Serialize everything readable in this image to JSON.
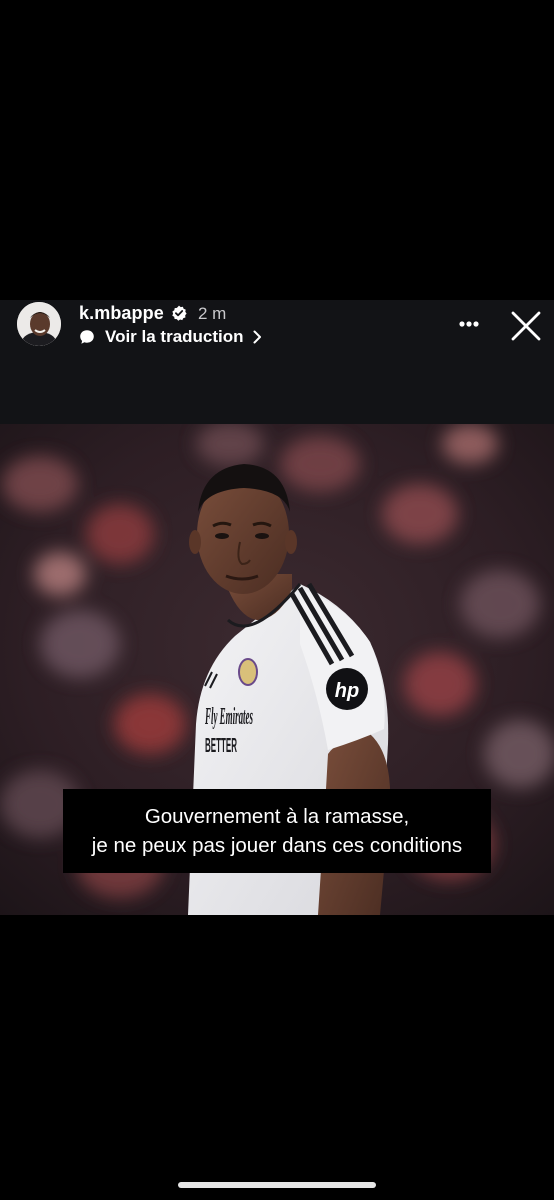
{
  "story": {
    "username": "k.mbappe",
    "verified": true,
    "time_ago": "2 m",
    "translate_label": "Voir la traduction"
  },
  "caption": {
    "line1": "Gouvernement à la ramasse,",
    "line2": "je ne peux pas jouer dans ces conditions"
  },
  "photo": {
    "jersey_sponsor_line1": "Fly Emirates",
    "jersey_sponsor_line2": "BETTER",
    "sleeve_logo": "hp"
  },
  "icons": {
    "verified": "verified-badge-icon",
    "translate": "speech-bubble-icon",
    "chevron": "chevron-right-icon",
    "more": "more-options-icon",
    "close": "close-icon"
  },
  "colors": {
    "header_background": "#121316",
    "page_background": "#000000",
    "caption_background": "#000000",
    "verified_badge": "#ffffff",
    "home_indicator": "#e6e6e6"
  }
}
